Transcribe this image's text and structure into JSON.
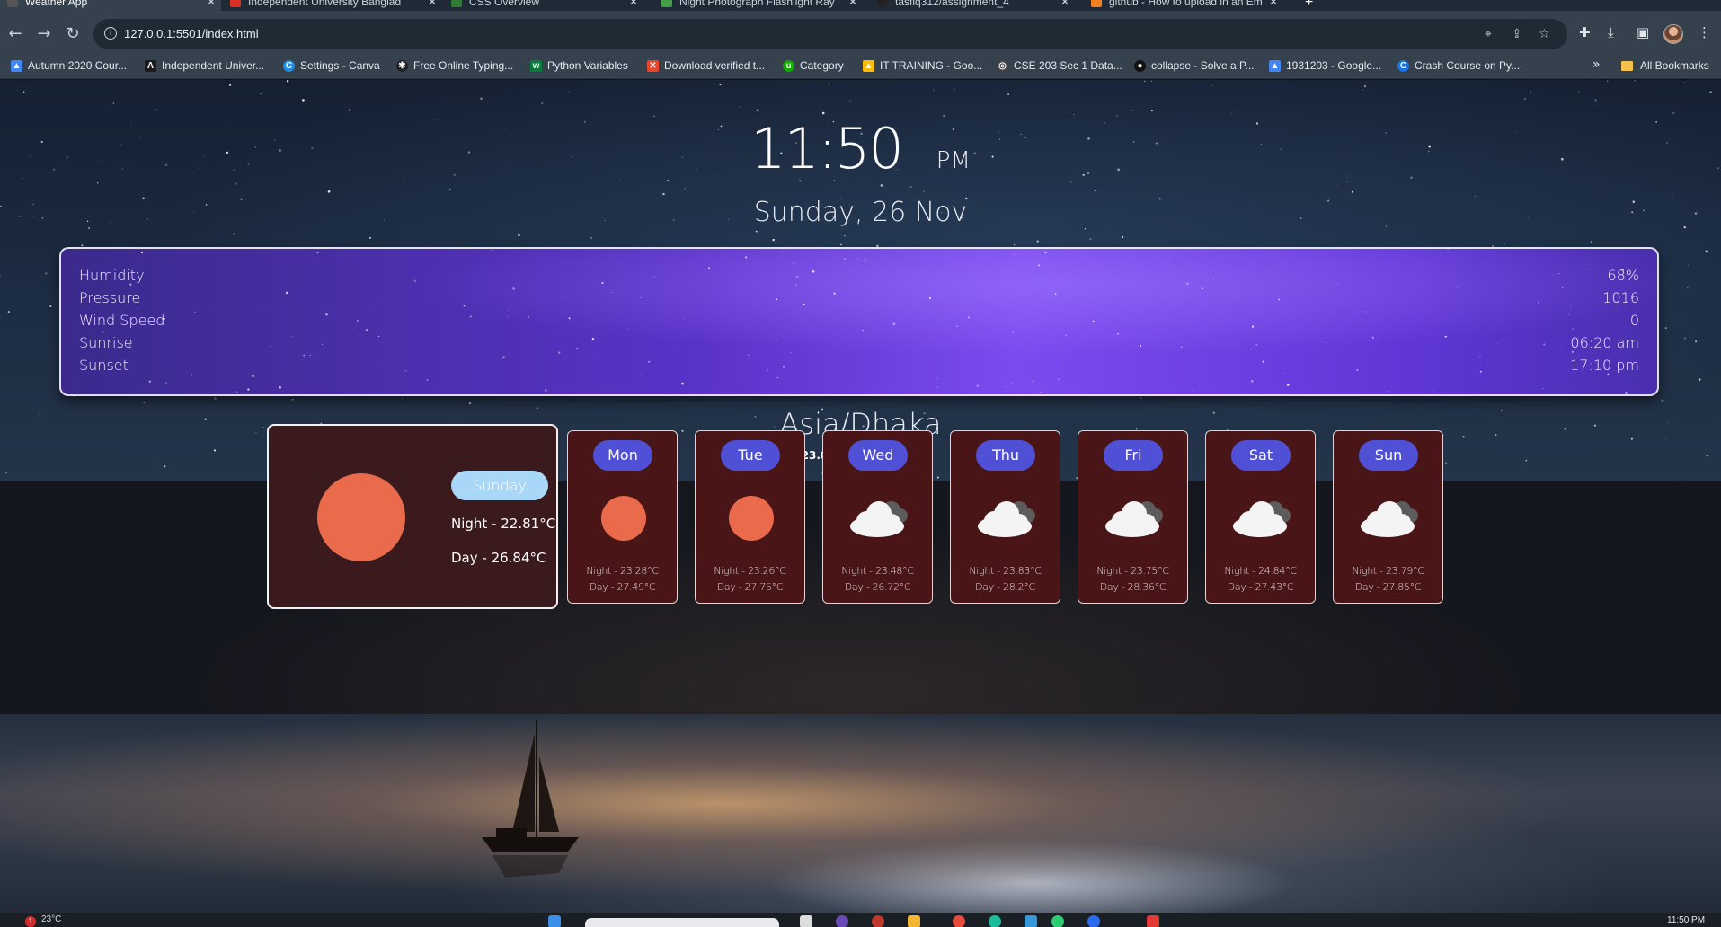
{
  "browser": {
    "tabs": [
      {
        "title": "Weather App",
        "active": true
      },
      {
        "title": "Independent University Banglad",
        "active": false
      },
      {
        "title": "CSS Overview",
        "active": false
      },
      {
        "title": "Night Photograph Flashlight Ray",
        "active": false
      },
      {
        "title": "tasfiq312/assignment_4",
        "active": false
      },
      {
        "title": "github - How to upload in an Em",
        "active": false
      }
    ],
    "new_tab": "+",
    "url": "127.0.0.1:5501/index.html",
    "bookmarks": [
      {
        "label": "Autumn 2020 Cour..."
      },
      {
        "label": "Independent Univer..."
      },
      {
        "label": "Settings - Canva"
      },
      {
        "label": "Free Online Typing..."
      },
      {
        "label": "Python Variables"
      },
      {
        "label": "Download verified t..."
      },
      {
        "label": "Category"
      },
      {
        "label": "IT TRAINING - Goo..."
      },
      {
        "label": "CSE 203 Sec 1 Data..."
      },
      {
        "label": "collapse - Solve a P..."
      },
      {
        "label": "1931203 - Google..."
      },
      {
        "label": "Crash Course on Py..."
      }
    ],
    "bookmarks_more": "»",
    "all_bookmarks": "All Bookmarks"
  },
  "clock": {
    "time": "11:50",
    "ampm": "PM",
    "date": "Sunday, 26 Nov"
  },
  "details": [
    {
      "label": "Humidity",
      "value": "68%"
    },
    {
      "label": "Pressure",
      "value": "1016"
    },
    {
      "label": "Wind Speed",
      "value": "0"
    },
    {
      "label": "Sunrise",
      "value": "06:20 am"
    },
    {
      "label": "Sunset",
      "value": "17:10 pm"
    }
  ],
  "location": {
    "timezone": "Asia/Dhaka",
    "coords": "23.8702N 90.3987E"
  },
  "today": {
    "day": "Sunday",
    "night": "Night - 22.81°C",
    "day_temp": "Day - 26.84°C",
    "icon": "sun-icon"
  },
  "forecast": [
    {
      "day": "Mon",
      "icon": "sun-icon",
      "night": "Night - 23.28°C",
      "day_temp": "Day - 27.49°C"
    },
    {
      "day": "Tue",
      "icon": "sun-icon",
      "night": "Night - 23.26°C",
      "day_temp": "Day - 27.76°C"
    },
    {
      "day": "Wed",
      "icon": "cloud-icon",
      "night": "Night - 23.48°C",
      "day_temp": "Day - 26.72°C"
    },
    {
      "day": "Thu",
      "icon": "cloud-icon",
      "night": "Night - 23.83°C",
      "day_temp": "Day - 28.2°C"
    },
    {
      "day": "Fri",
      "icon": "cloud-icon",
      "night": "Night - 23.75°C",
      "day_temp": "Day - 28.36°C"
    },
    {
      "day": "Sat",
      "icon": "cloud-icon",
      "night": "Night - 24.84°C",
      "day_temp": "Day - 27.43°C"
    },
    {
      "day": "Sun",
      "icon": "cloud-icon",
      "night": "Night - 23.79°C",
      "day_temp": "Day - 27.85°C"
    }
  ],
  "taskbar": {
    "weather": "23°C",
    "badge": "1",
    "clock": "11:50 PM"
  },
  "colors": {
    "accent_pill": "#5050d7",
    "today_pill": "#a9d7f8",
    "sun": "#ea6a4c",
    "card_bg": "#4a1517",
    "details_purple": "#5a33c9"
  }
}
